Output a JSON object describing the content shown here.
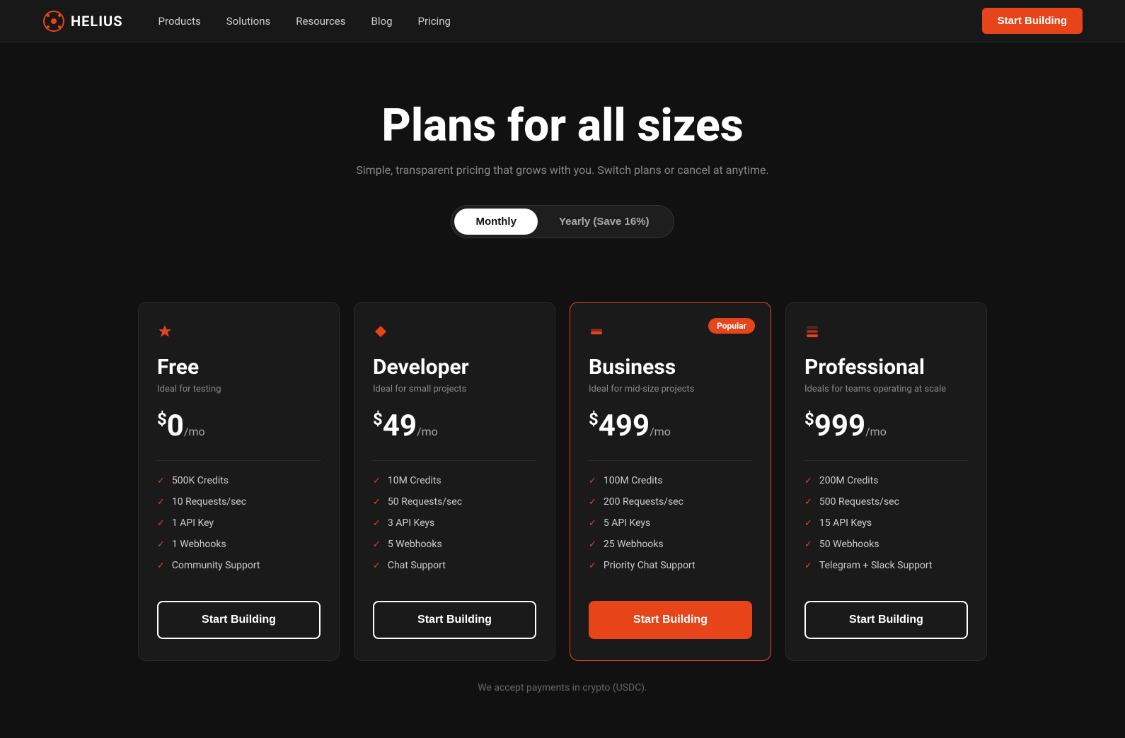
{
  "nav": {
    "logo_text": "HELIUS",
    "links": [
      "Products",
      "Solutions",
      "Resources",
      "Blog",
      "Pricing"
    ],
    "cta": "Start Building"
  },
  "hero": {
    "title": "Plans for all sizes",
    "subtitle": "Simple, transparent pricing that grows with you. Switch plans or cancel at anytime."
  },
  "toggle": {
    "monthly_label": "Monthly",
    "yearly_label": "Yearly (Save 16%)",
    "active": "monthly"
  },
  "plans": [
    {
      "id": "free",
      "icon": "⚡",
      "name": "Free",
      "desc": "Ideal for testing",
      "price": "$",
      "price_number": "0",
      "price_suffix": "/mo",
      "popular": false,
      "features": [
        "500K Credits",
        "10 Requests/sec",
        "1 API Key",
        "1 Webhooks",
        "Community Support"
      ],
      "cta": "Start Building",
      "primary": false
    },
    {
      "id": "developer",
      "icon": "◆",
      "name": "Developer",
      "desc": "Ideal for small projects",
      "price": "$",
      "price_number": "49",
      "price_suffix": "/mo",
      "popular": false,
      "features": [
        "10M Credits",
        "50 Requests/sec",
        "3 API Keys",
        "5 Webhooks",
        "Chat Support"
      ],
      "cta": "Start Building",
      "primary": false
    },
    {
      "id": "business",
      "icon": "◈",
      "name": "Business",
      "desc": "Ideal for mid-size projects",
      "price": "$",
      "price_number": "499",
      "price_suffix": "/mo",
      "popular": true,
      "popular_label": "Popular",
      "features": [
        "100M Credits",
        "200 Requests/sec",
        "5 API Keys",
        "25 Webhooks",
        "Priority Chat Support"
      ],
      "cta": "Start Building",
      "primary": true
    },
    {
      "id": "professional",
      "icon": "◉",
      "name": "Professional",
      "desc": "Ideals for teams operating at scale",
      "price": "$",
      "price_number": "999",
      "price_suffix": "/mo",
      "popular": false,
      "features": [
        "200M Credits",
        "500 Requests/sec",
        "15 API Keys",
        "50 Webhooks",
        "Telegram + Slack  Support"
      ],
      "cta": "Start Building",
      "primary": false
    }
  ],
  "footer": {
    "note": "We accept payments in crypto (USDC)."
  }
}
